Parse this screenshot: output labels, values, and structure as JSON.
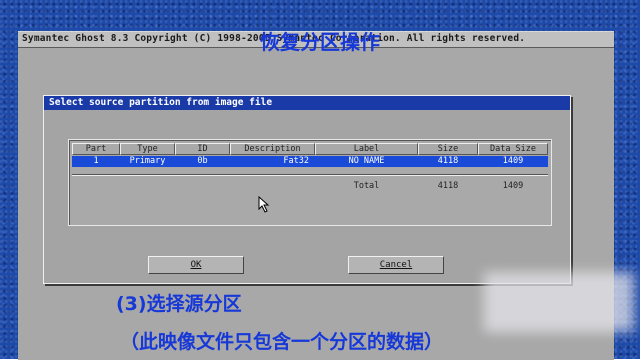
{
  "window": {
    "title": "Symantec Ghost 8.3   Copyright (C) 1998-2005 Symantec Corporation. All rights reserved."
  },
  "caption_top": "恢复分区操作",
  "dialog": {
    "title": "Select source partition from image file"
  },
  "table": {
    "headers": [
      "Part",
      "Type",
      "ID",
      "Description",
      "Label",
      "Size",
      "Data Size"
    ],
    "rows": [
      {
        "part": "1",
        "type": "Primary",
        "id": "0b",
        "description": "Fat32",
        "label": "NO NAME",
        "size": "4118",
        "data_size": "1409"
      }
    ],
    "total": {
      "label": "Total",
      "size": "4118",
      "data_size": "1409"
    }
  },
  "buttons": {
    "ok": "OK",
    "cancel": "Cancel"
  },
  "caption_step": "(3)选择源分区",
  "caption_note": "（此映像文件只包含一个分区的数据）",
  "colors": {
    "background": "#1d49a8",
    "caption": "#1638d8",
    "selection": "#1a4ad8",
    "dialog_title": "#1a3aa8"
  },
  "cursor": "arrow-pointer-icon"
}
